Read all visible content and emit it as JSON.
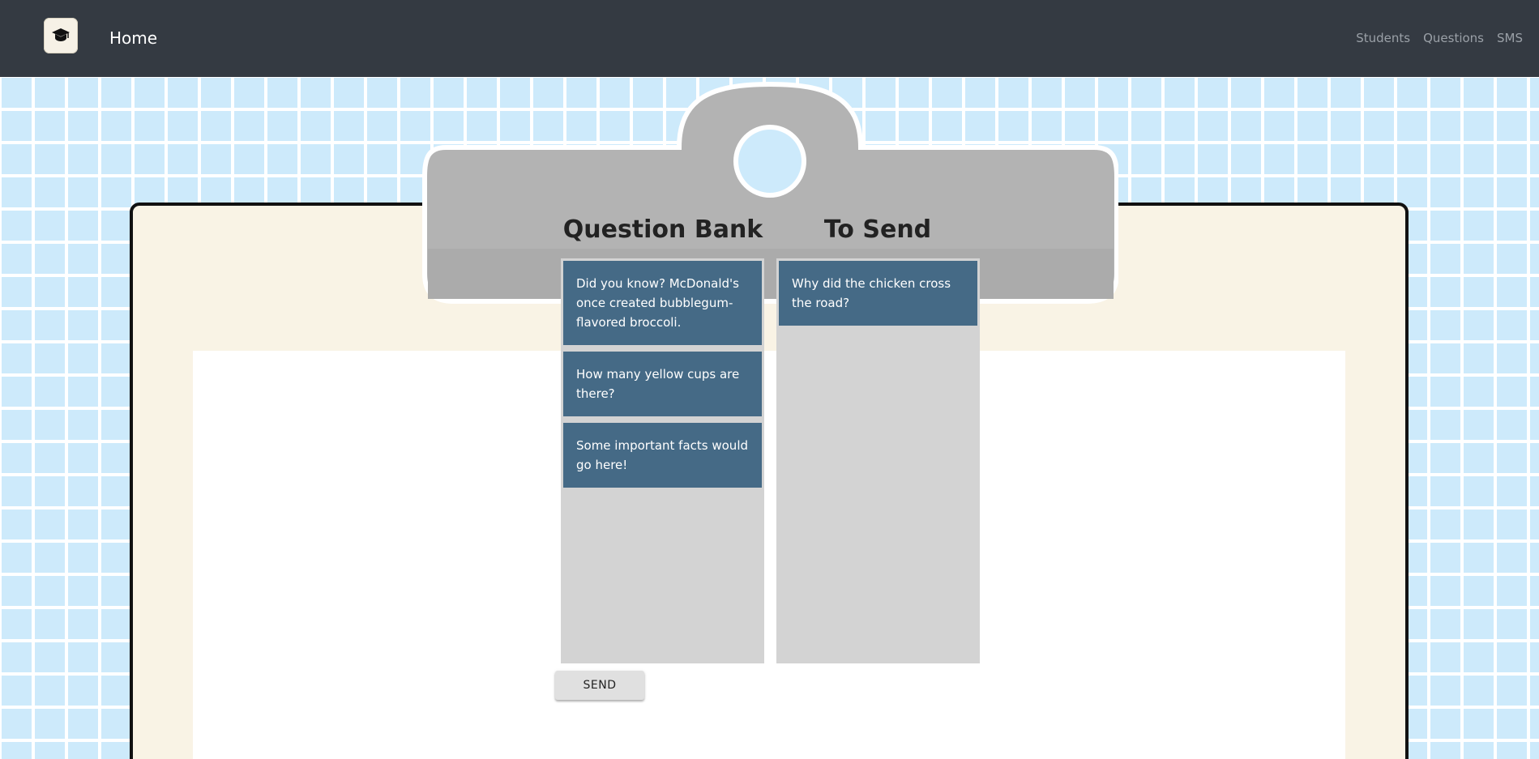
{
  "navbar": {
    "logo_icon": "graduation-cap-icon",
    "home_label": "Home",
    "links": [
      {
        "label": "Students"
      },
      {
        "label": "Questions"
      },
      {
        "label": "SMS"
      }
    ]
  },
  "columns": {
    "bank": {
      "title": "Question Bank",
      "cards": [
        {
          "text": "Did you know? McDonald's once created bubblegum-flavored broccoli."
        },
        {
          "text": "How many yellow cups are there?"
        },
        {
          "text": "Some important facts would go here!"
        }
      ]
    },
    "send": {
      "title": "To Send",
      "cards": [
        {
          "text": "Why did the chicken cross the road?"
        }
      ]
    }
  },
  "send_button": {
    "label": "SEND"
  },
  "colors": {
    "navbar": "#343a42",
    "card": "#456a86",
    "column": "#d3d3d3",
    "board": "#f9f3e5",
    "background": "#cdeafb"
  }
}
